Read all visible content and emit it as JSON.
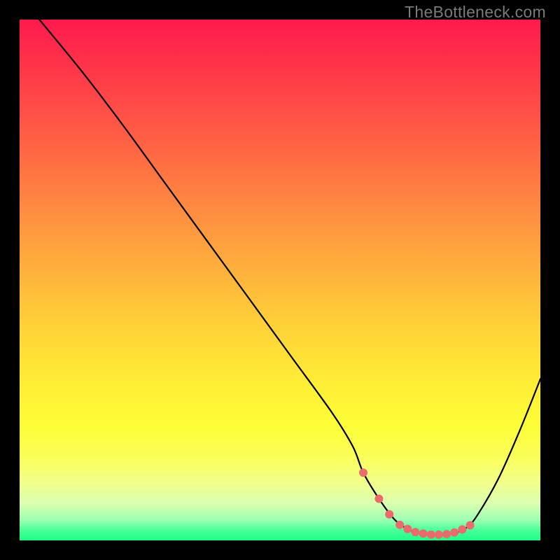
{
  "watermark": "TheBottleneck.com",
  "colors": {
    "background": "#000000",
    "gradient_top": "#ff1a4d",
    "gradient_bottom": "#1cff86",
    "curve_stroke": "#000000",
    "marker_fill": "#e86b6d"
  },
  "chart_data": {
    "type": "line",
    "title": "",
    "xlabel": "",
    "ylabel": "",
    "xlim": [
      0,
      100
    ],
    "ylim": [
      0,
      100
    ],
    "grid": false,
    "legend": false,
    "series": [
      {
        "name": "bottleneck-curve",
        "x": [
          3.8,
          12,
          20,
          28,
          36,
          44,
          52,
          60,
          64,
          66,
          69,
          72,
          74.5,
          77,
          79.5,
          82,
          84,
          86,
          88,
          92,
          96,
          100
        ],
        "values": [
          100,
          90,
          79.5,
          68.5,
          57.5,
          46.5,
          35.5,
          24.5,
          18,
          13,
          8,
          4,
          2.2,
          1.3,
          1.1,
          1.2,
          1.6,
          2.6,
          5,
          12,
          21,
          31
        ]
      }
    ],
    "markers": {
      "note": "highlighted points along the flat bottom of the curve",
      "x": [
        66,
        69,
        71,
        73,
        74.5,
        76,
        77.5,
        79,
        80.5,
        82,
        83.5,
        85,
        86.5
      ],
      "values": [
        13,
        8,
        5,
        3,
        2.2,
        1.6,
        1.3,
        1.1,
        1.1,
        1.2,
        1.5,
        2.1,
        2.9
      ]
    }
  }
}
